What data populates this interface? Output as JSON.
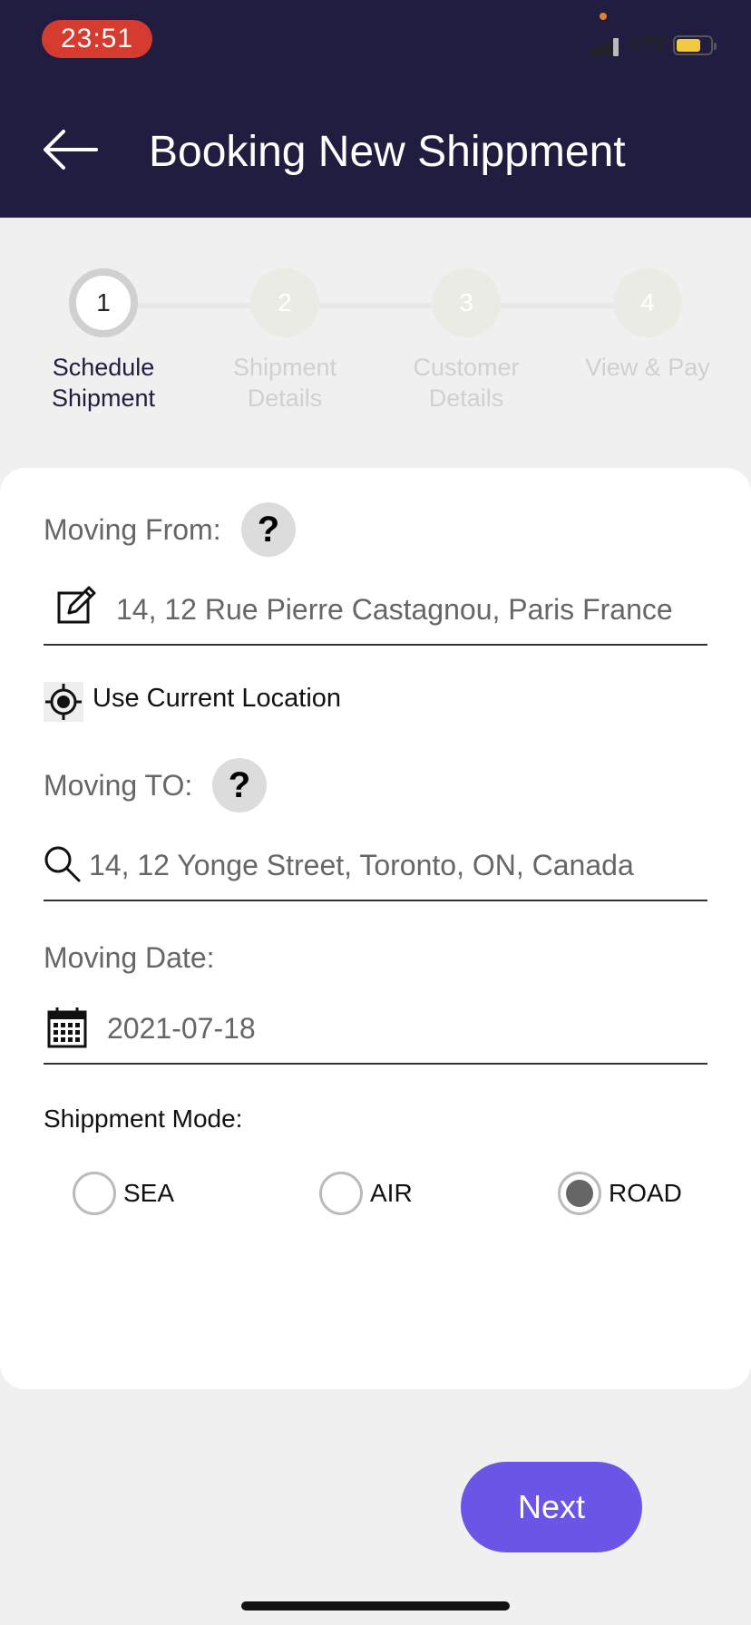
{
  "status_bar": {
    "time": "23:51",
    "network": "LTE"
  },
  "header": {
    "title": "Booking New Shippment"
  },
  "stepper": {
    "steps": [
      {
        "number": "1",
        "label_line1": "Schedule",
        "label_line2": "Shipment"
      },
      {
        "number": "2",
        "label_line1": "Shipment",
        "label_line2": "Details"
      },
      {
        "number": "3",
        "label_line1": "Customer",
        "label_line2": "Details"
      },
      {
        "number": "4",
        "label_line1": "View & Pay",
        "label_line2": ""
      }
    ]
  },
  "form": {
    "moving_from": {
      "label": "Moving From:",
      "help": "?",
      "value": "14, 12 Rue Pierre Castagnou, Paris France"
    },
    "use_current_location": "Use Current Location",
    "moving_to": {
      "label": "Moving TO:",
      "help": "?",
      "value": "14, 12 Yonge Street, Toronto, ON, Canada"
    },
    "moving_date": {
      "label": "Moving Date:",
      "value": "2021-07-18"
    },
    "shipment_mode": {
      "label": "Shippment Mode:",
      "options": [
        "SEA",
        "AIR",
        "ROAD"
      ],
      "selected": "ROAD"
    }
  },
  "actions": {
    "next_label": "Next"
  },
  "colors": {
    "header_bg": "#201d40",
    "accent": "#6b55e6",
    "time_pill": "#d63b30"
  }
}
